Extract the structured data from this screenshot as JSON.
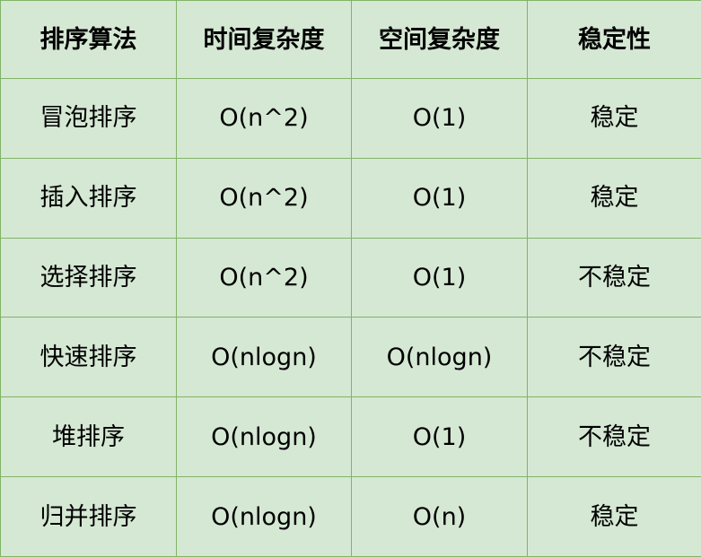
{
  "table": {
    "headers": [
      "排序算法",
      "时间复杂度",
      "空间复杂度",
      "稳定性"
    ],
    "rows": [
      [
        "冒泡排序",
        "O(n^2)",
        "O(1)",
        "稳定"
      ],
      [
        "插入排序",
        "O(n^2)",
        "O(1)",
        "稳定"
      ],
      [
        "选择排序",
        "O(n^2)",
        "O(1)",
        "不稳定"
      ],
      [
        "快速排序",
        "O(nlogn)",
        "O(nlogn)",
        "不稳定"
      ],
      [
        "堆排序",
        "O(nlogn)",
        "O(1)",
        "不稳定"
      ],
      [
        "归并排序",
        "O(nlogn)",
        "O(n)",
        "稳定"
      ]
    ]
  },
  "colors": {
    "cell_background": "#d5e8d4",
    "border": "#82b366",
    "text": "#000000"
  }
}
